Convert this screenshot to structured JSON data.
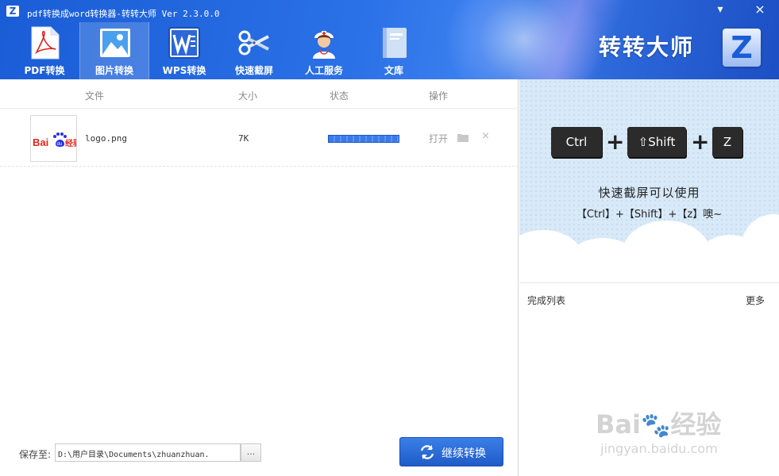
{
  "window": {
    "title": "pdf转换成word转换器-转转大师 Ver 2.3.0.0",
    "logo_letter": "Z",
    "minimize_glyph": "▾",
    "close_glyph": "×"
  },
  "toolbar": {
    "items": [
      {
        "label": "PDF转换",
        "icon": "pdf-icon"
      },
      {
        "label": "图片转换",
        "icon": "image-icon",
        "active": true
      },
      {
        "label": "WPS转换",
        "icon": "wps-icon"
      },
      {
        "label": "快速截屏",
        "icon": "scissors-icon"
      },
      {
        "label": "人工服务",
        "icon": "nurse-icon"
      },
      {
        "label": "文库",
        "icon": "book-icon"
      }
    ]
  },
  "brand": {
    "name": "转转大师",
    "letter": "Z"
  },
  "file_table": {
    "columns": [
      "文件",
      "大小",
      "状态",
      "操作"
    ],
    "rows": [
      {
        "thumb_text": "Bai",
        "thumb_text2": "经验",
        "name": "logo.png",
        "size": "7K",
        "progress": 1.0,
        "action_open": "打开",
        "delete_glyph": "×"
      }
    ]
  },
  "footer": {
    "save_label": "保存至:",
    "save_path": "D:\\用户目录\\Documents\\zhuanzhuan.",
    "browse_label": "...",
    "convert_label": "继续转换"
  },
  "banner": {
    "keys": [
      "Ctrl",
      "⇧Shift",
      "Z"
    ],
    "plus": "+",
    "tip_line1": "快速截屏可以使用",
    "tip_line2": "【Ctrl】+【Shift】+【z】噢~"
  },
  "done_list": {
    "title": "完成列表",
    "more": "更多"
  },
  "watermark": {
    "text": "Bai",
    "text2": "经验",
    "sub": "jingyan.baidu.com"
  },
  "colors": {
    "primary": "#1f5cc9",
    "header": "#2a70e6",
    "banner_bg": "#d8e9f8"
  }
}
